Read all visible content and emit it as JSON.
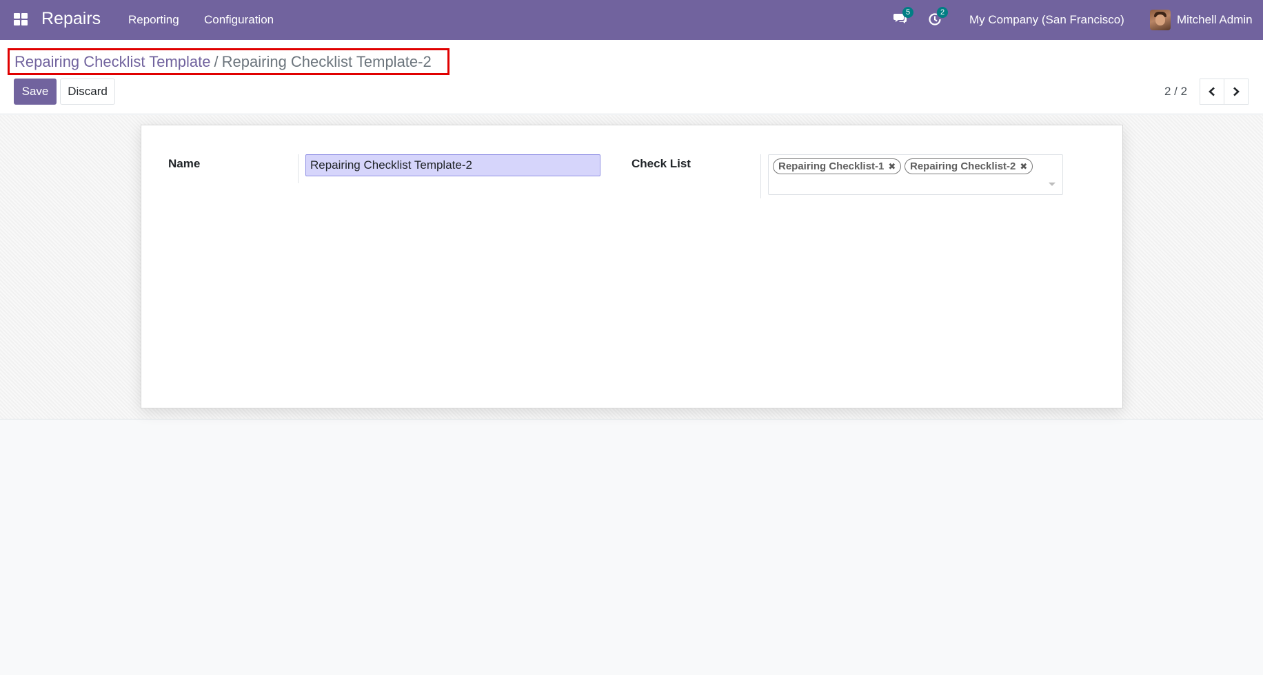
{
  "navbar": {
    "apps_icon": "apps-grid-icon",
    "app_name": "Repairs",
    "menu": [
      "Reporting",
      "Configuration"
    ],
    "messages_icon": "chat-icon",
    "messages_count": "5",
    "activities_icon": "clock-icon",
    "activities_count": "2",
    "company": "My Company (San Francisco)",
    "user": "Mitchell Admin"
  },
  "breadcrumb": {
    "parent": "Repairing Checklist Template",
    "separator": "/",
    "current": "Repairing Checklist Template-2"
  },
  "actions": {
    "save": "Save",
    "discard": "Discard"
  },
  "pager": {
    "value": "2 / 2",
    "prev_icon": "chevron-left-icon",
    "next_icon": "chevron-right-icon"
  },
  "form": {
    "name_label": "Name",
    "name_value": "Repairing Checklist Template-2",
    "checklist_label": "Check List",
    "checklist_tags": [
      "Repairing Checklist-1",
      "Repairing Checklist-2"
    ],
    "remove_tag_symbol": "✖"
  },
  "colors": {
    "brand": "#71639e",
    "badge": "#017e84",
    "highlight_border": "#e00000",
    "input_focus_bg": "#d6d5fb"
  }
}
